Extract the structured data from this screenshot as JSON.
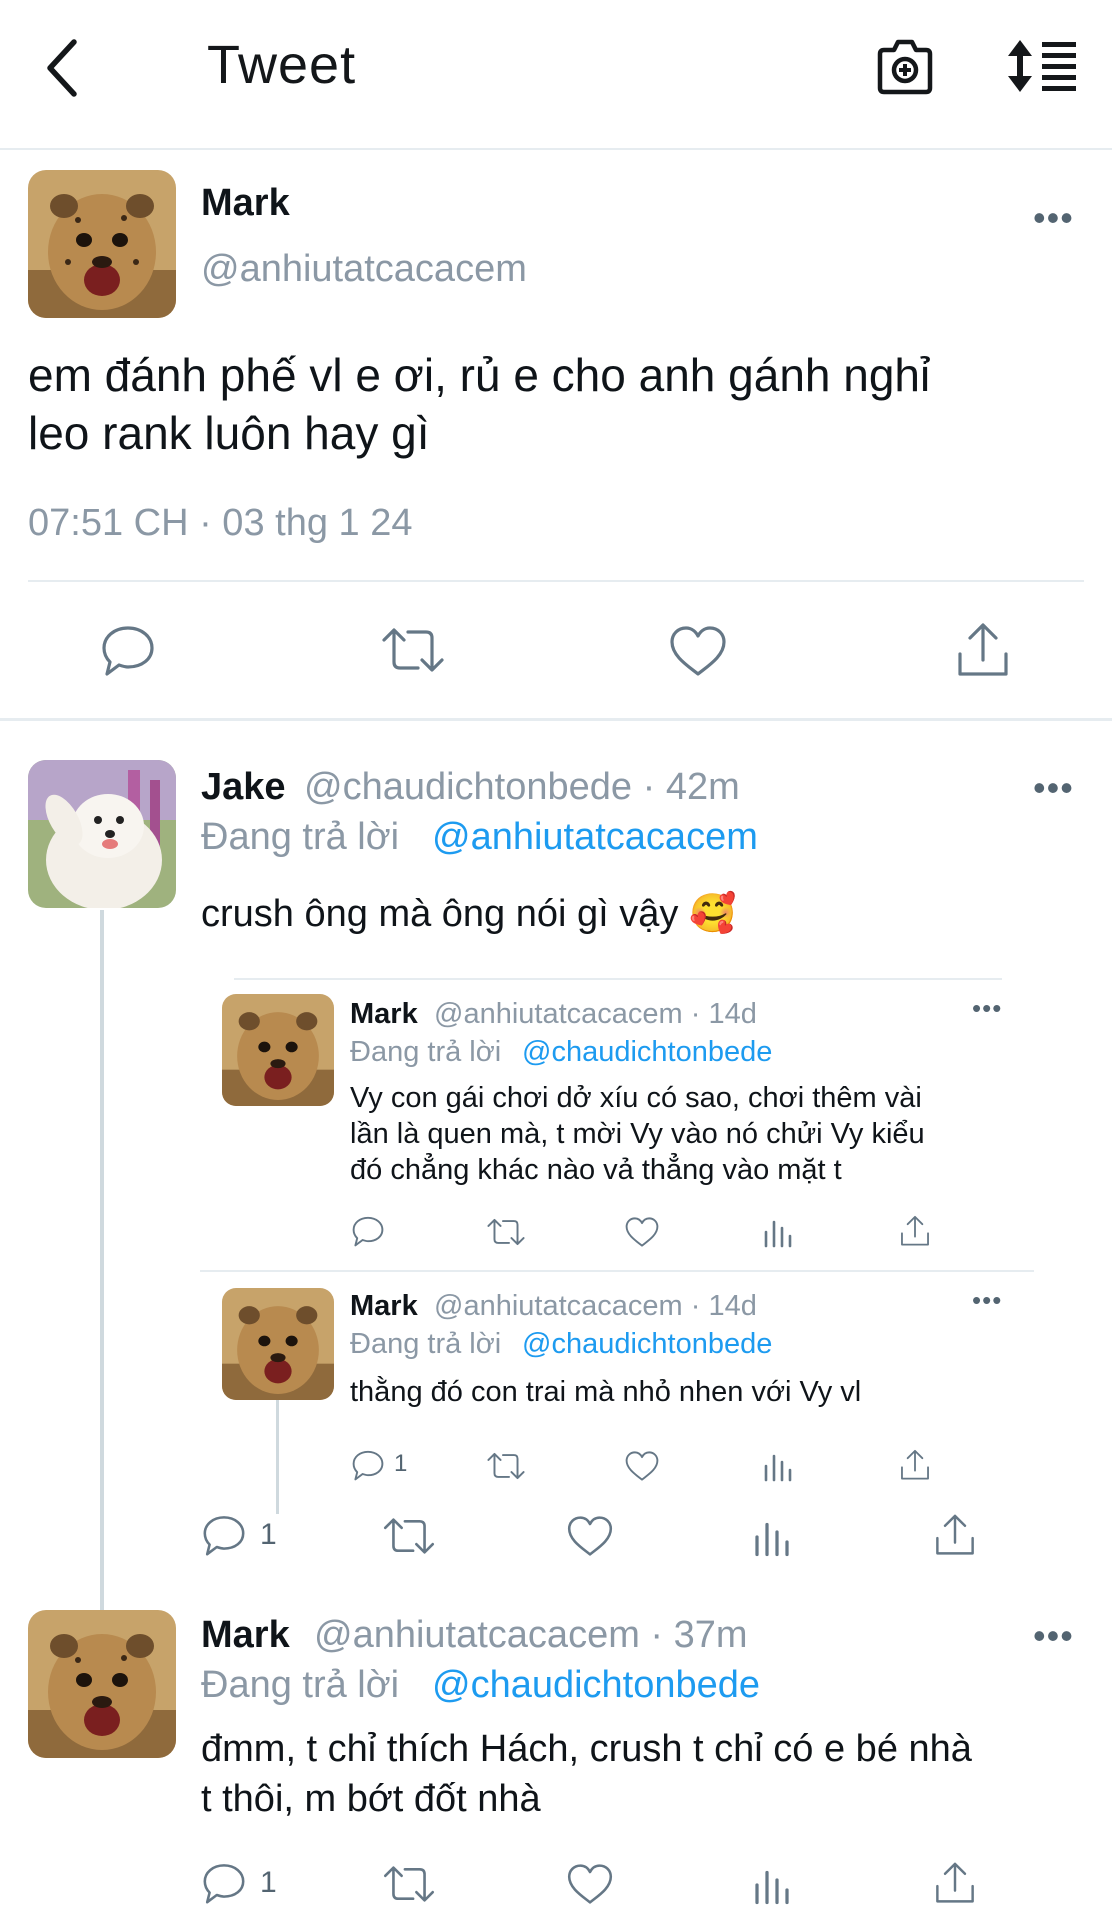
{
  "header": {
    "title": "Tweet"
  },
  "main_tweet": {
    "name": "Mark",
    "handle": "@anhiutatcacacem",
    "text_line1": "em đánh phế vl e ơi, rủ e cho anh gánh nghỉ",
    "text_line2": "leo rank luôn hay gì",
    "timestamp": "07:51 CH · 03 thg 1 24"
  },
  "reply_jake": {
    "name": "Jake",
    "handle": "@chaudichtonbede · 42m",
    "replying_label": "Đang trả lời",
    "replying_to": "@anhiutatcacacem",
    "text": "crush ông mà ông nói gì vậy 🥰",
    "reply_count": "1"
  },
  "nested_1": {
    "name": "Mark",
    "handle": "@anhiutatcacacem · 14d",
    "replying_label": "Đang trả lời",
    "replying_to": "@chaudichtonbede",
    "line1": "Vy con gái chơi dở xíu có sao, chơi thêm vài",
    "line2": "lần là quen mà, t mời Vy vào nó chửi Vy kiểu",
    "line3": "đó chẳng khác nào vả thẳng vào mặt t"
  },
  "nested_2": {
    "name": "Mark",
    "handle": "@anhiutatcacacem · 14d",
    "replying_label": "Đang trả lời",
    "replying_to": "@chaudichtonbede",
    "text": "thằng đó con trai mà nhỏ nhen với Vy vl",
    "reply_count": "1"
  },
  "reply_mark": {
    "name": "Mark",
    "handle": "@anhiutatcacacem · 37m",
    "replying_label": "Đang trả lời",
    "replying_to": "@chaudichtonbede",
    "line1": "đmm, t chỉ thích Hách, crush t chỉ có e bé nhà",
    "line2": "t thôi, m bớt đốt nhà",
    "reply_count": "1"
  },
  "colors": {
    "link": "#1d9bf0",
    "secondary": "#8b98a5",
    "icon": "#657786"
  }
}
